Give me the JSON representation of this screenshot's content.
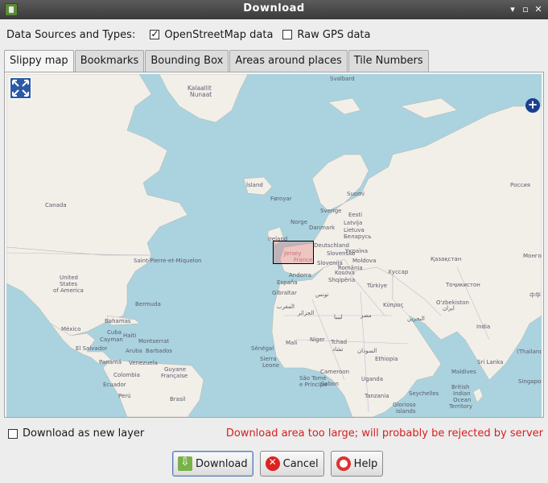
{
  "window": {
    "title": "Download",
    "icon": "josm-app-icon"
  },
  "sources": {
    "label": "Data Sources and Types:",
    "options": [
      {
        "label": "OpenStreetMap data",
        "checked": true
      },
      {
        "label": "Raw GPS data",
        "checked": false
      }
    ]
  },
  "tabs": [
    {
      "label": "Slippy map",
      "active": true
    },
    {
      "label": "Bookmarks",
      "active": false
    },
    {
      "label": "Bounding Box",
      "active": false
    },
    {
      "label": "Areas around places",
      "active": false
    },
    {
      "label": "Tile Numbers",
      "active": false
    }
  ],
  "map": {
    "labels": {
      "kalaallit": "Kalaallit",
      "nunaat": "Nunaat",
      "svalbard": "Svalbard",
      "island": "Ísland",
      "foroyar": "Føroyar",
      "suomi": "Suomi",
      "sverige": "Sverige",
      "norge": "Norge",
      "eesti": "Eesti",
      "latvija": "Latvija",
      "lietuva": "Lietuva",
      "danmark": "Danmark",
      "belarus": "Беларусь",
      "ireland": "Ireland",
      "deutschland": "Deutschland",
      "slovensko": "Slovensko",
      "ukraina": "Україна",
      "moldova": "Moldova",
      "slovenija": "Slovenija",
      "romania": "România",
      "jersey": "Jersey",
      "france": "France",
      "andorra": "Andorra",
      "kosova": "Kosova",
      "shqiperia": "Shqipëria",
      "espana": "España",
      "turkiye": "Türkiye",
      "kazakhstan": "Қазақстан",
      "russia": "Россия",
      "canada": "Canada",
      "spm": "Saint-Pierre-et-Miquelon",
      "us1": "United",
      "us2": "States",
      "us3": "of America",
      "bermuda": "Bermuda",
      "gibraltar": "Gibraltar",
      "mexico": "México",
      "bahamas": "Bahamas",
      "cuba": "Cuba",
      "haiti": "Haiti",
      "cayman": "Cayman",
      "montserrat": "Montserrat",
      "elsalvador": "El Salvador",
      "aruba": "Aruba",
      "barbados": "Barbados",
      "panama": "Panamá",
      "venezuela": "Venezuela",
      "colombia": "Colombia",
      "guyane1": "Guyane",
      "guyane2": "Française",
      "ecuador": "Ecuador",
      "peru": "Perú",
      "brasil": "Brasil",
      "mali": "Mali",
      "niger": "Niger",
      "tchad": "Tchad",
      "senegal": "Sénégal",
      "sierra": "Sierra",
      "leone": "Leone",
      "cameroon": "Cameroon",
      "saotome1": "São Tomé",
      "saotome2": "e Príncipe",
      "gabon": "Gabon",
      "ethiopia": "Ethiopia",
      "uganda": "Uganda",
      "tanzania": "Tanzania",
      "seychelles": "Seychelles",
      "biot1": "British",
      "biot2": "Indian",
      "biot3": "Ocean",
      "biot4": "Territory",
      "glorioso1": "Glorioso",
      "glorioso2": "Islands",
      "maldives": "Maldives",
      "srilanka": "Sri Lanka",
      "india": "India",
      "uzbekistan": "O'zbekiston",
      "thailand": "(Thailand)",
      "singapore": "Singapore",
      "kypros": "Κύπρος",
      "misr": "مصر",
      "libya": "ليبيا",
      "sudan": "السودان",
      "tunisia": "تونس",
      "aljazair": "الجزائر",
      "maghrib": "المغرب",
      "mongolia": "Монго",
      "hay": "Хуссар",
      "tojik": "Тоҷикистон",
      "chad2": "تشاد",
      "bahrain": "البحرين",
      "iran": "ایران",
      "cn": "中华"
    }
  },
  "bottom": {
    "new_layer_label": "Download as new layer",
    "new_layer_checked": false,
    "warning": "Download area too large; will probably be rejected by server"
  },
  "buttons": {
    "download": "Download",
    "cancel": "Cancel",
    "help": "Help"
  },
  "colors": {
    "water": "#aad3df",
    "land": "#f2efe9",
    "warning": "#d62020",
    "selection": "#e67878"
  }
}
